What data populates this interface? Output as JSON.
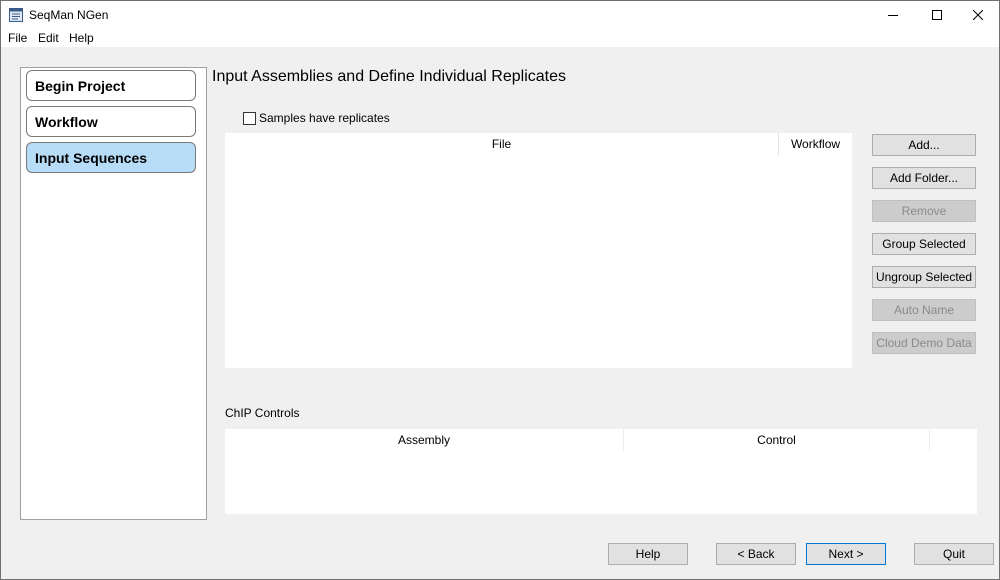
{
  "window": {
    "title": "SeqMan NGen",
    "icon": "app-window-icon"
  },
  "menu": {
    "items": [
      "File",
      "Edit",
      "Help"
    ]
  },
  "nav": {
    "items": [
      {
        "label": "Begin Project",
        "active": false
      },
      {
        "label": "Workflow",
        "active": false
      },
      {
        "label": "Input Sequences",
        "active": true
      }
    ]
  },
  "main": {
    "title": "Input Assemblies and Define Individual Replicates",
    "replicates_checkbox": {
      "label": "Samples have replicates",
      "checked": false
    },
    "file_table": {
      "columns": [
        "File",
        "Workflow"
      ],
      "rows": []
    },
    "side_buttons": [
      {
        "label": "Add...",
        "enabled": true
      },
      {
        "label": "Add Folder...",
        "enabled": true
      },
      {
        "label": "Remove",
        "enabled": false
      },
      {
        "label": "Group Selected",
        "enabled": true
      },
      {
        "label": "Ungroup Selected",
        "enabled": true
      },
      {
        "label": "Auto Name",
        "enabled": false
      },
      {
        "label": "Cloud Demo Data",
        "enabled": false
      }
    ],
    "chip": {
      "label": "ChIP Controls",
      "columns": [
        "Assembly",
        "Control"
      ],
      "rows": []
    }
  },
  "footer": {
    "help": "Help",
    "back": "< Back",
    "next": "Next >",
    "quit": "Quit"
  },
  "colors": {
    "active_nav": "#b7dcf7",
    "primary_border": "#0078d7",
    "disabled_text": "#8a8a8a"
  }
}
